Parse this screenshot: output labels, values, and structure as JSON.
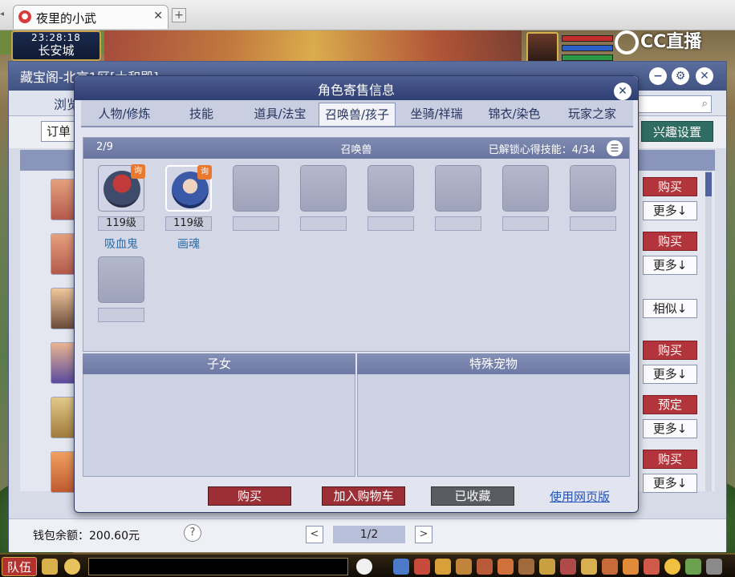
{
  "browser": {
    "tab_title": "夜里的小武",
    "tab_close": "✕",
    "new_tab": "+"
  },
  "scene": {
    "clock_time": "23:28:18",
    "city": "长安城",
    "stream_logo": "CC直播"
  },
  "treasure": {
    "title": "藏宝阁-北京1区[大和殿]",
    "nav_tab": "浏览",
    "order_button": "订单",
    "interest_button": "兴趣设置",
    "rows": [
      {
        "primary": "购买",
        "secondary": "更多↓"
      },
      {
        "primary": "购买",
        "secondary": "更多↓"
      },
      {
        "primary": "",
        "secondary": "相似↓"
      },
      {
        "primary": "购买",
        "secondary": "更多↓"
      },
      {
        "primary": "预定",
        "secondary": "更多↓"
      },
      {
        "primary": "购买",
        "secondary": "更多↓"
      }
    ],
    "wallet": "钱包余额：200.60元",
    "help": "?",
    "page": "1/2",
    "prev": "<",
    "next": ">"
  },
  "modal": {
    "title": "角色寄售信息",
    "close": "✕",
    "tabs": [
      "人物/修炼",
      "技能",
      "道具/法宝",
      "召唤兽/孩子",
      "坐骑/祥瑞",
      "锦衣/染色",
      "玩家之家"
    ],
    "active_tab_index": 3,
    "pets": {
      "count": "2/9",
      "label": "召唤兽",
      "skills": "已解锁心得技能：4/34",
      "ask_badge": "询",
      "items": [
        {
          "level": "119级",
          "name": "吸血鬼"
        },
        {
          "level": "119级",
          "name": "画魂"
        }
      ]
    },
    "children_label": "子女",
    "special_label": "特殊宠物",
    "buy_button": "购买",
    "cart_button": "加入购物车",
    "fav_button": "已收藏",
    "web_link": "使用网页版"
  },
  "hud": {
    "team_button": "队伍"
  },
  "colors": {
    "modal_header": "#2f3f72",
    "buy_red": "#9c2f36",
    "link_blue": "#2253b8",
    "pet_name_blue": "#2a6ea8"
  }
}
